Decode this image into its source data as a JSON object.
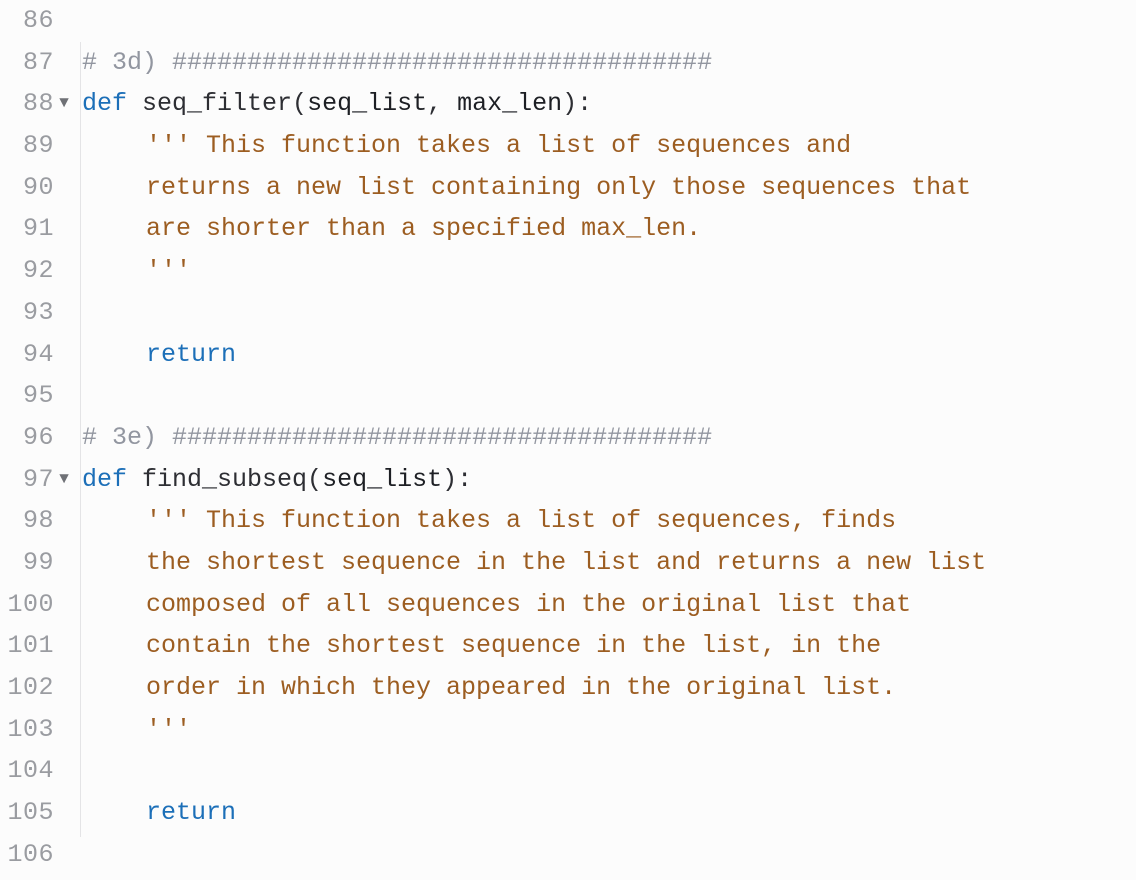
{
  "lines": [
    {
      "num": "86",
      "fold": "",
      "indent": true,
      "tokens": []
    },
    {
      "num": "87",
      "fold": "",
      "indent": false,
      "tokens": [
        {
          "cls": "c-comment",
          "text": "# 3d) ####################################"
        }
      ]
    },
    {
      "num": "88",
      "fold": "▼",
      "indent": false,
      "tokens": [
        {
          "cls": "c-kw",
          "text": "def "
        },
        {
          "cls": "c-func",
          "text": "seq_filter"
        },
        {
          "cls": "c-punc",
          "text": "("
        },
        {
          "cls": "c-param",
          "text": "seq_list"
        },
        {
          "cls": "c-punc",
          "text": ", "
        },
        {
          "cls": "c-param",
          "text": "max_len"
        },
        {
          "cls": "c-punc",
          "text": "):"
        }
      ]
    },
    {
      "num": "89",
      "fold": "",
      "indent": true,
      "tokens": [
        {
          "cls": "c-str",
          "text": "''' This function takes a list of sequences and"
        }
      ]
    },
    {
      "num": "90",
      "fold": "",
      "indent": true,
      "tokens": [
        {
          "cls": "c-str",
          "text": "returns a new list containing only those sequences that"
        }
      ]
    },
    {
      "num": "91",
      "fold": "",
      "indent": true,
      "tokens": [
        {
          "cls": "c-str",
          "text": "are shorter than a specified max_len."
        }
      ]
    },
    {
      "num": "92",
      "fold": "",
      "indent": true,
      "tokens": [
        {
          "cls": "c-str",
          "text": "'''"
        }
      ]
    },
    {
      "num": "93",
      "fold": "",
      "indent": true,
      "tokens": []
    },
    {
      "num": "94",
      "fold": "",
      "indent": true,
      "tokens": [
        {
          "cls": "c-kw",
          "text": "return"
        }
      ]
    },
    {
      "num": "95",
      "fold": "",
      "indent": true,
      "tokens": []
    },
    {
      "num": "96",
      "fold": "",
      "indent": false,
      "tokens": [
        {
          "cls": "c-comment",
          "text": "# 3e) ####################################"
        }
      ]
    },
    {
      "num": "97",
      "fold": "▼",
      "indent": false,
      "tokens": [
        {
          "cls": "c-kw",
          "text": "def "
        },
        {
          "cls": "c-func",
          "text": "find_subseq"
        },
        {
          "cls": "c-punc",
          "text": "("
        },
        {
          "cls": "c-param",
          "text": "seq_list"
        },
        {
          "cls": "c-punc",
          "text": "):"
        }
      ]
    },
    {
      "num": "98",
      "fold": "",
      "indent": true,
      "tokens": [
        {
          "cls": "c-str",
          "text": "''' This function takes a list of sequences, finds"
        }
      ]
    },
    {
      "num": "99",
      "fold": "",
      "indent": true,
      "tokens": [
        {
          "cls": "c-str",
          "text": "the shortest sequence in the list and returns a new list"
        }
      ]
    },
    {
      "num": "100",
      "fold": "",
      "indent": true,
      "tokens": [
        {
          "cls": "c-str",
          "text": "composed of all sequences in the original list that"
        }
      ]
    },
    {
      "num": "101",
      "fold": "",
      "indent": true,
      "tokens": [
        {
          "cls": "c-str",
          "text": "contain the shortest sequence in the list, in the"
        }
      ]
    },
    {
      "num": "102",
      "fold": "",
      "indent": true,
      "tokens": [
        {
          "cls": "c-str",
          "text": "order in which they appeared in the original list."
        }
      ]
    },
    {
      "num": "103",
      "fold": "",
      "indent": true,
      "tokens": [
        {
          "cls": "c-str",
          "text": "'''"
        }
      ]
    },
    {
      "num": "104",
      "fold": "",
      "indent": true,
      "tokens": []
    },
    {
      "num": "105",
      "fold": "",
      "indent": true,
      "tokens": [
        {
          "cls": "c-kw",
          "text": "return"
        }
      ]
    },
    {
      "num": "106",
      "fold": "",
      "indent": true,
      "tokens": []
    }
  ]
}
